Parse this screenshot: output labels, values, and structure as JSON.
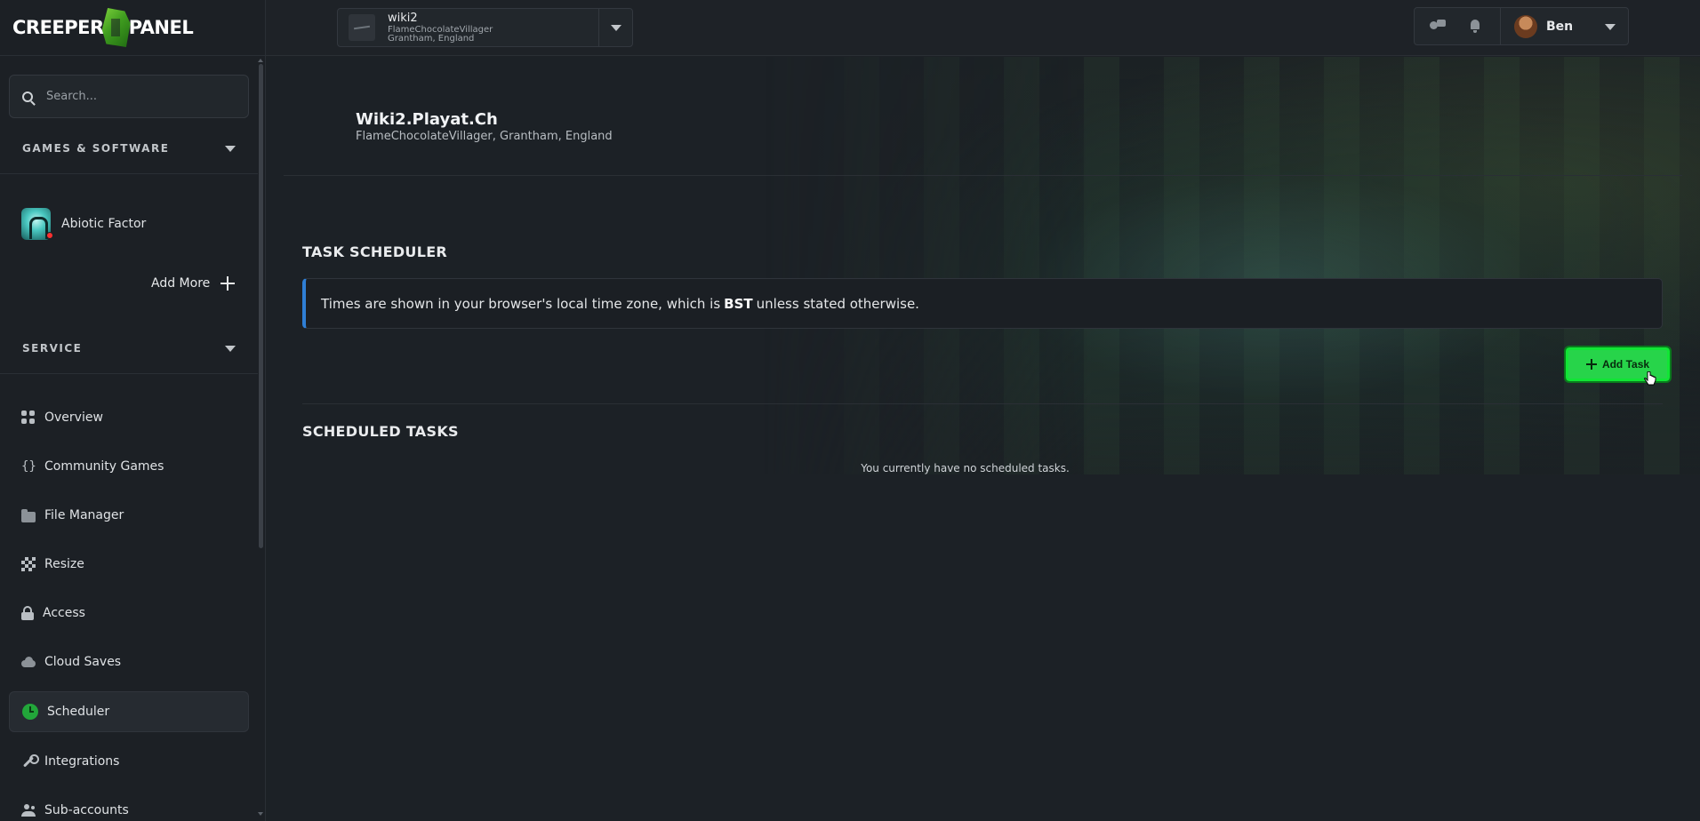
{
  "brand": {
    "logo_left": "CREEPER",
    "logo_right": "PANEL"
  },
  "sidebar": {
    "search_placeholder": "Search...",
    "games_section": "GAMES & SOFTWARE",
    "game": {
      "name": "Abiotic Factor"
    },
    "add_more": "Add More",
    "service_section": "SERVICE",
    "items": [
      {
        "label": "Overview",
        "icon": "overview-grid-icon"
      },
      {
        "label": "Community Games",
        "icon": "braces-icon"
      },
      {
        "label": "File Manager",
        "icon": "folder-icon"
      },
      {
        "label": "Resize",
        "icon": "resize-icon"
      },
      {
        "label": "Access",
        "icon": "lock-icon"
      },
      {
        "label": "Cloud Saves",
        "icon": "cloud-icon"
      },
      {
        "label": "Scheduler",
        "icon": "clock-icon",
        "active": true
      },
      {
        "label": "Integrations",
        "icon": "wrench-icon"
      },
      {
        "label": "Sub-accounts",
        "icon": "users-icon"
      }
    ]
  },
  "topbar": {
    "server": {
      "name": "wiki2",
      "line1": "FlameChocolateVillager",
      "line2": "Grantham, England"
    },
    "user": {
      "name": "Ben"
    }
  },
  "main": {
    "title": "Wiki2.Playat.Ch",
    "subtitle": "FlameChocolateVillager, Grantham, England",
    "task_scheduler_title": "TASK SCHEDULER",
    "info_prefix": "Times are shown in your browser's local time zone, which is",
    "info_tz": "BST",
    "info_suffix": "unless stated otherwise.",
    "add_task_label": "Add Task",
    "scheduled_title": "SCHEDULED TASKS",
    "empty_message": "You currently have no scheduled tasks."
  },
  "colors": {
    "accent_green": "#27d44a",
    "info_accent": "#2f7fd6",
    "background": "#1c2126"
  }
}
